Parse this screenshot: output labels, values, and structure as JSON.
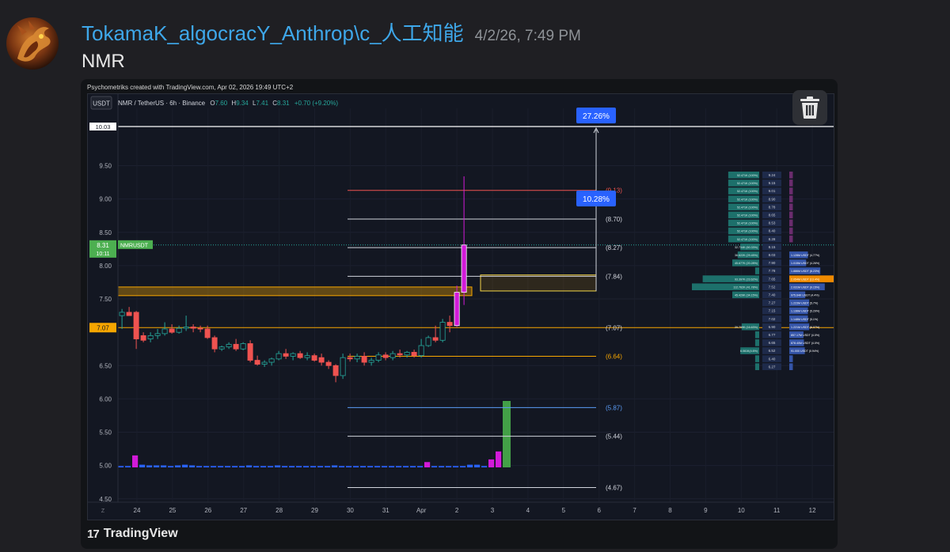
{
  "message": {
    "author": "TokamaK_algocracY_Anthrop\\c_人工知能",
    "timestamp": "4/2/26, 7:49 PM",
    "text": "NMR"
  },
  "embed": {
    "caption": "Psychometriks created with TradingView.com, Apr 02, 2026 19:49 UTC+2",
    "brand": "TradingView",
    "brand_logo": "17"
  },
  "chart_header": {
    "currency_button": "USDT",
    "symbol": "NMR / TetherUS · 6h · Binance",
    "open_label": "O",
    "open": "7.60",
    "high_label": "H",
    "high": "9.34",
    "low_label": "L",
    "low": "7.41",
    "close_label": "C",
    "close": "8.31",
    "change": "+0.70 (+9.20%)"
  },
  "colors": {
    "up": "#26a69a",
    "down": "#ef5350",
    "magenta": "#d21ad9",
    "volume_blue": "#2962ff",
    "bg": "#131722",
    "orange": "#f7a600",
    "badge_blue": "#2962ff",
    "green_label": "#4caf50"
  },
  "chart_data": {
    "type": "candlestick",
    "symbol": "NMRUSDT",
    "timeframe": "6h",
    "y_ticks": [
      "9.50",
      "9.00",
      "8.50",
      "8.00",
      "7.50",
      "6.50",
      "6.00",
      "5.50",
      "5.00",
      "4.50"
    ],
    "ylim": [
      4.45,
      10.1
    ],
    "x_ticks": [
      "24",
      "25",
      "26",
      "27",
      "28",
      "29",
      "30",
      "31",
      "Apr",
      "2",
      "3",
      "4",
      "5",
      "6",
      "7",
      "8",
      "9",
      "10",
      "11",
      "12"
    ],
    "axis_corner": "Z",
    "price_labels": {
      "top_line": "10.03",
      "current": "8.31",
      "current_name": "NMRUSDT",
      "countdown": "10:11",
      "orange_level": "7.07"
    },
    "candles": [
      {
        "o": 7.25,
        "h": 7.35,
        "l": 7.05,
        "c": 7.3
      },
      {
        "o": 7.3,
        "h": 7.38,
        "l": 7.25,
        "c": 7.25
      },
      {
        "o": 7.3,
        "h": 7.32,
        "l": 6.75,
        "c": 6.9
      },
      {
        "o": 6.95,
        "h": 7.0,
        "l": 6.85,
        "c": 6.88
      },
      {
        "o": 6.9,
        "h": 7.0,
        "l": 6.85,
        "c": 6.95
      },
      {
        "o": 6.95,
        "h": 7.05,
        "l": 6.9,
        "c": 6.98
      },
      {
        "o": 6.98,
        "h": 7.15,
        "l": 6.95,
        "c": 7.05
      },
      {
        "o": 7.05,
        "h": 7.12,
        "l": 6.98,
        "c": 7.0
      },
      {
        "o": 7.0,
        "h": 7.1,
        "l": 6.98,
        "c": 7.06
      },
      {
        "o": 7.06,
        "h": 7.25,
        "l": 7.02,
        "c": 7.08
      },
      {
        "o": 7.08,
        "h": 7.12,
        "l": 7.0,
        "c": 7.06
      },
      {
        "o": 7.06,
        "h": 7.1,
        "l": 7.0,
        "c": 7.05
      },
      {
        "o": 7.05,
        "h": 7.1,
        "l": 6.9,
        "c": 6.92
      },
      {
        "o": 6.92,
        "h": 6.95,
        "l": 6.7,
        "c": 6.75
      },
      {
        "o": 6.75,
        "h": 6.8,
        "l": 6.72,
        "c": 6.78
      },
      {
        "o": 6.78,
        "h": 6.85,
        "l": 6.75,
        "c": 6.82
      },
      {
        "o": 6.82,
        "h": 6.9,
        "l": 6.72,
        "c": 6.75
      },
      {
        "o": 6.75,
        "h": 6.85,
        "l": 6.73,
        "c": 6.83
      },
      {
        "o": 6.83,
        "h": 6.88,
        "l": 6.55,
        "c": 6.58
      },
      {
        "o": 6.58,
        "h": 6.65,
        "l": 6.5,
        "c": 6.52
      },
      {
        "o": 6.52,
        "h": 6.58,
        "l": 6.48,
        "c": 6.55
      },
      {
        "o": 6.55,
        "h": 6.62,
        "l": 6.5,
        "c": 6.6
      },
      {
        "o": 6.6,
        "h": 6.72,
        "l": 6.58,
        "c": 6.68
      },
      {
        "o": 6.68,
        "h": 6.75,
        "l": 6.6,
        "c": 6.64
      },
      {
        "o": 6.64,
        "h": 6.7,
        "l": 6.58,
        "c": 6.68
      },
      {
        "o": 6.68,
        "h": 6.72,
        "l": 6.6,
        "c": 6.62
      },
      {
        "o": 6.62,
        "h": 6.7,
        "l": 6.58,
        "c": 6.65
      },
      {
        "o": 6.65,
        "h": 6.68,
        "l": 6.56,
        "c": 6.58
      },
      {
        "o": 6.62,
        "h": 6.68,
        "l": 6.5,
        "c": 6.55
      },
      {
        "o": 6.55,
        "h": 6.58,
        "l": 6.45,
        "c": 6.5
      },
      {
        "o": 6.5,
        "h": 6.52,
        "l": 6.25,
        "c": 6.35
      },
      {
        "o": 6.35,
        "h": 6.68,
        "l": 6.3,
        "c": 6.62
      },
      {
        "o": 6.62,
        "h": 6.68,
        "l": 6.56,
        "c": 6.6
      },
      {
        "o": 6.6,
        "h": 6.68,
        "l": 6.55,
        "c": 6.64
      },
      {
        "o": 6.64,
        "h": 6.7,
        "l": 6.5,
        "c": 6.55
      },
      {
        "o": 6.55,
        "h": 6.62,
        "l": 6.5,
        "c": 6.58
      },
      {
        "o": 6.58,
        "h": 6.7,
        "l": 6.55,
        "c": 6.66
      },
      {
        "o": 6.66,
        "h": 6.7,
        "l": 6.58,
        "c": 6.62
      },
      {
        "o": 6.62,
        "h": 6.72,
        "l": 6.58,
        "c": 6.68
      },
      {
        "o": 6.68,
        "h": 6.74,
        "l": 6.62,
        "c": 6.66
      },
      {
        "o": 6.66,
        "h": 6.72,
        "l": 6.62,
        "c": 6.7
      },
      {
        "o": 6.7,
        "h": 6.74,
        "l": 6.62,
        "c": 6.65
      },
      {
        "o": 6.65,
        "h": 6.9,
        "l": 6.62,
        "c": 6.8
      },
      {
        "o": 6.8,
        "h": 6.95,
        "l": 6.78,
        "c": 6.92
      },
      {
        "o": 6.92,
        "h": 7.1,
        "l": 6.85,
        "c": 6.88
      },
      {
        "o": 6.88,
        "h": 7.2,
        "l": 6.85,
        "c": 7.15
      },
      {
        "o": 7.15,
        "h": 7.25,
        "l": 7.0,
        "c": 7.1
      },
      {
        "o": 7.1,
        "h": 7.7,
        "l": 7.08,
        "c": 7.6
      },
      {
        "o": 7.6,
        "h": 9.34,
        "l": 7.41,
        "c": 8.31
      }
    ],
    "volumes": [
      0.02,
      0.02,
      0.18,
      0.04,
      0.03,
      0.03,
      0.03,
      0.02,
      0.03,
      0.04,
      0.03,
      0.02,
      0.02,
      0.02,
      0.02,
      0.02,
      0.02,
      0.02,
      0.03,
      0.02,
      0.02,
      0.02,
      0.03,
      0.02,
      0.02,
      0.02,
      0.02,
      0.02,
      0.02,
      0.02,
      0.03,
      0.02,
      0.02,
      0.02,
      0.02,
      0.02,
      0.02,
      0.02,
      0.02,
      0.02,
      0.02,
      0.02,
      0.02,
      0.08,
      0.02,
      0.02,
      0.02,
      0.02,
      0.02,
      0.04,
      0.04,
      0.02,
      0.12,
      0.24,
      1.0
    ],
    "volume_colors": [
      "blue",
      "blue",
      "magenta",
      "blue",
      "blue",
      "blue",
      "blue",
      "blue",
      "blue",
      "blue",
      "blue",
      "blue",
      "blue",
      "blue",
      "blue",
      "blue",
      "blue",
      "blue",
      "blue",
      "blue",
      "blue",
      "blue",
      "blue",
      "blue",
      "blue",
      "blue",
      "blue",
      "blue",
      "blue",
      "blue",
      "blue",
      "blue",
      "blue",
      "blue",
      "blue",
      "blue",
      "blue",
      "blue",
      "blue",
      "blue",
      "blue",
      "blue",
      "blue",
      "magenta",
      "blue",
      "blue",
      "blue",
      "blue",
      "blue",
      "blue",
      "blue",
      "blue",
      "magenta",
      "magenta",
      "green"
    ],
    "levels": [
      {
        "label": "(9.13)",
        "price": 9.13,
        "color": "#ef5350"
      },
      {
        "label": "(8.70)",
        "price": 8.7,
        "color": "#d1d4dc"
      },
      {
        "label": "(8.27)",
        "price": 8.27,
        "color": "#d1d4dc"
      },
      {
        "label": "(7.84)",
        "price": 7.84,
        "color": "#d1d4dc"
      },
      {
        "label": "(7.07)",
        "price": 7.07,
        "color": "#d1d4dc"
      },
      {
        "label": "(6.64)",
        "price": 6.64,
        "color": "#f7a600"
      },
      {
        "label": "(5.87)",
        "price": 5.87,
        "color": "#5b9cf6"
      },
      {
        "label": "(5.44)",
        "price": 5.44,
        "color": "#d1d4dc"
      },
      {
        "label": "(4.67)",
        "price": 4.67,
        "color": "#d1d4dc"
      }
    ],
    "badges": [
      "27.26%",
      "10.28%"
    ],
    "order_book": {
      "prices": [
        "9.24",
        "9.15",
        "9.01",
        "8.90",
        "8.78",
        "8.65",
        "8.53",
        "8.40",
        "8.28",
        "8.15",
        "8.03",
        "7.90",
        "7.78",
        "7.65",
        "7.52",
        "7.40",
        "7.27",
        "7.15",
        "7.02",
        "6.90",
        "6.77",
        "6.65",
        "6.52",
        "6.40",
        "6.27"
      ],
      "asks": [
        "52.471K (100%)",
        "52.471K (100%)",
        "52.471K (100%)",
        "52.471K (100%)",
        "52.471K (100%)",
        "52.471K (100%)",
        "52.471K (100%)",
        "52.471K (100%)",
        "52.471K (100%)",
        "32.734K (60.33%)",
        "36.622K (29.45%)",
        "45.677K (20.28%)",
        "",
        "93.397K (23.62%)",
        "112.762K (41.78%)",
        "45.429K (34.15%)",
        "",
        "",
        "",
        "29.799K (16.63%)",
        "",
        "",
        "6.061K(4.6%)",
        "",
        ""
      ],
      "ask_fills": [
        0.23,
        0.23,
        0.23,
        0.23,
        0.23,
        0.23,
        0.23,
        0.23,
        0.23,
        0.14,
        0.16,
        0.2,
        0.03,
        0.42,
        0.5,
        0.2,
        0.0,
        0.0,
        0.0,
        0.13,
        0.03,
        0.03,
        0.14,
        0.03,
        0.03
      ],
      "bids": [
        "",
        "",
        "",
        "",
        "",
        "",
        "",
        "",
        "",
        "",
        "1.128M USDT (4.77%)",
        "1.015M USDT (4.26%)",
        "1.886M USDT (8.23%)",
        "2.054M USDT (13.4%)",
        "2.031M USDT (9.15%)",
        "975.64K USDT (4.4%)",
        "1.223M USDT (5.7%)",
        "1.136M USDT (5.29%)",
        "1.148M USDT (5.1%)",
        "1.221M USDT (6.07%)",
        "857.17M USDT (4.0%)",
        "878.40M USDT (4.0%)",
        "91.000 USDT (0.94%)",
        "",
        ""
      ],
      "bid_fills": [
        0.08,
        0.08,
        0.08,
        0.08,
        0.08,
        0.08,
        0.08,
        0.08,
        0.08,
        0.0,
        0.42,
        0.38,
        0.7,
        1.0,
        0.8,
        0.36,
        0.45,
        0.42,
        0.42,
        0.45,
        0.32,
        0.33,
        0.35,
        0.08,
        0.08
      ]
    }
  }
}
